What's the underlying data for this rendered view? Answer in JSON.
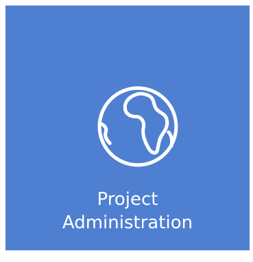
{
  "tile": {
    "icon": "globe-icon",
    "label_line1": "Project",
    "label_line2": "Administration",
    "background_color": "#4f7fd1",
    "text_color": "#ffffff"
  }
}
